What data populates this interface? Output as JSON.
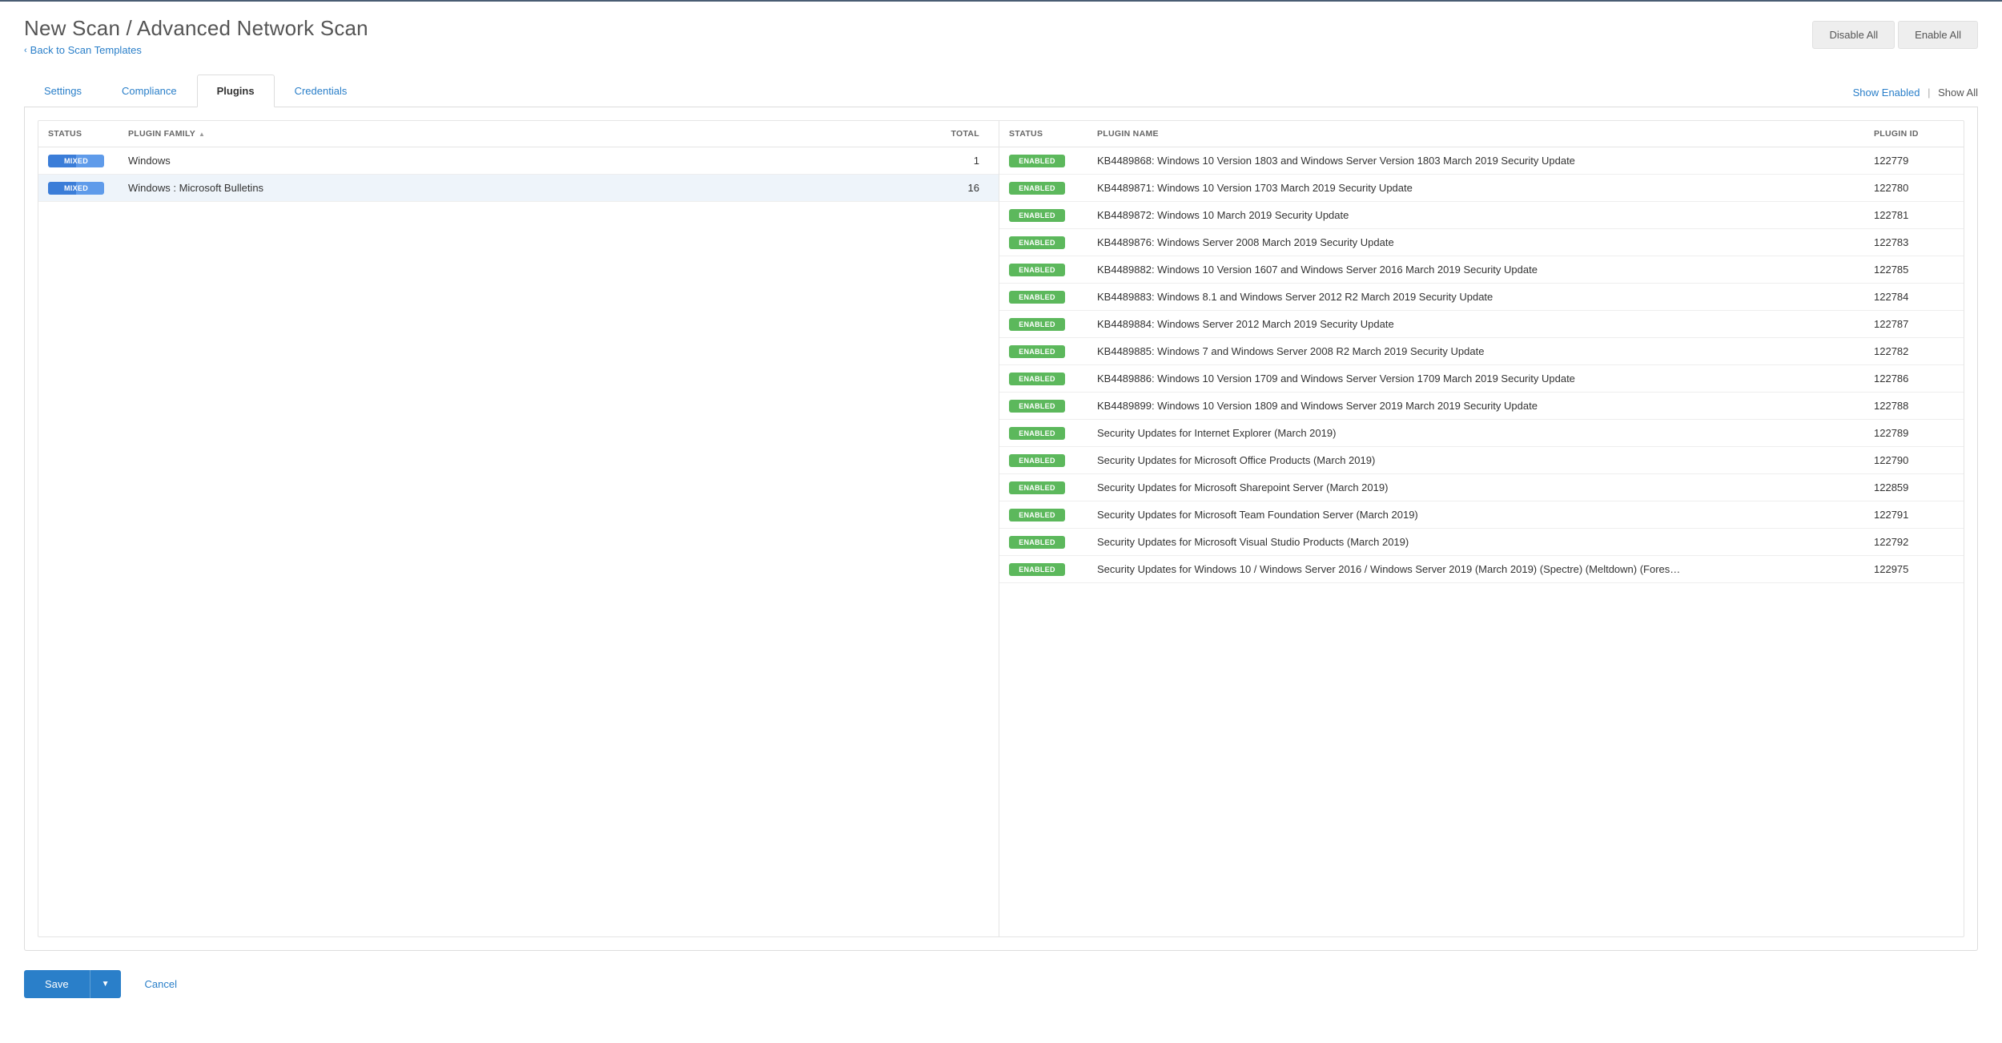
{
  "header": {
    "title": "New Scan / Advanced Network Scan",
    "back_label": "Back to Scan Templates",
    "disable_all": "Disable All",
    "enable_all": "Enable All"
  },
  "tabs": {
    "settings": "Settings",
    "compliance": "Compliance",
    "plugins": "Plugins",
    "credentials": "Credentials"
  },
  "filter": {
    "show_enabled": "Show Enabled",
    "show_all": "Show All"
  },
  "left": {
    "th_status": "STATUS",
    "th_family": "PLUGIN FAMILY",
    "th_total": "TOTAL",
    "rows": [
      {
        "status": "MIXED",
        "family": "Windows",
        "total": "1",
        "selected": false
      },
      {
        "status": "MIXED",
        "family": "Windows : Microsoft Bulletins",
        "total": "16",
        "selected": true
      }
    ]
  },
  "right": {
    "th_status": "STATUS",
    "th_name": "PLUGIN NAME",
    "th_id": "PLUGIN ID",
    "rows": [
      {
        "status": "ENABLED",
        "name": "KB4489868: Windows 10 Version 1803 and Windows Server Version 1803 March 2019 Security Update",
        "id": "122779"
      },
      {
        "status": "ENABLED",
        "name": "KB4489871: Windows 10 Version 1703 March 2019 Security Update",
        "id": "122780"
      },
      {
        "status": "ENABLED",
        "name": "KB4489872: Windows 10 March 2019 Security Update",
        "id": "122781"
      },
      {
        "status": "ENABLED",
        "name": "KB4489876: Windows Server 2008 March 2019 Security Update",
        "id": "122783"
      },
      {
        "status": "ENABLED",
        "name": "KB4489882: Windows 10 Version 1607 and Windows Server 2016 March 2019 Security Update",
        "id": "122785"
      },
      {
        "status": "ENABLED",
        "name": "KB4489883: Windows 8.1 and Windows Server 2012 R2 March 2019 Security Update",
        "id": "122784"
      },
      {
        "status": "ENABLED",
        "name": "KB4489884: Windows Server 2012 March 2019 Security Update",
        "id": "122787"
      },
      {
        "status": "ENABLED",
        "name": "KB4489885: Windows 7 and Windows Server 2008 R2 March 2019 Security Update",
        "id": "122782"
      },
      {
        "status": "ENABLED",
        "name": "KB4489886: Windows 10 Version 1709 and Windows Server Version 1709 March 2019 Security Update",
        "id": "122786"
      },
      {
        "status": "ENABLED",
        "name": "KB4489899: Windows 10 Version 1809 and Windows Server 2019 March 2019 Security Update",
        "id": "122788"
      },
      {
        "status": "ENABLED",
        "name": "Security Updates for Internet Explorer (March 2019)",
        "id": "122789"
      },
      {
        "status": "ENABLED",
        "name": "Security Updates for Microsoft Office Products (March 2019)",
        "id": "122790"
      },
      {
        "status": "ENABLED",
        "name": "Security Updates for Microsoft Sharepoint Server (March 2019)",
        "id": "122859"
      },
      {
        "status": "ENABLED",
        "name": "Security Updates for Microsoft Team Foundation Server (March 2019)",
        "id": "122791"
      },
      {
        "status": "ENABLED",
        "name": "Security Updates for Microsoft Visual Studio Products (March 2019)",
        "id": "122792"
      },
      {
        "status": "ENABLED",
        "name": "Security Updates for Windows 10 / Windows Server 2016 / Windows Server 2019 (March 2019) (Spectre) (Meltdown) (Fores…",
        "id": "122975"
      }
    ]
  },
  "footer": {
    "save": "Save",
    "cancel": "Cancel"
  }
}
